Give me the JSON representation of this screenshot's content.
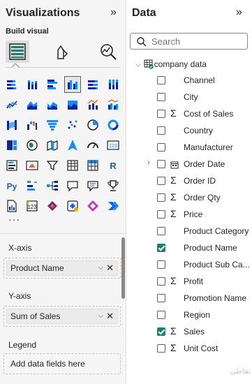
{
  "viz_pane": {
    "title": "Visualizations",
    "collapse_glyph": "»",
    "build_label": "Build visual",
    "modes": [
      "build-visual-icon",
      "format-visual-icon",
      "analytics-icon"
    ],
    "more_glyph": "···",
    "wells": [
      {
        "label": "X-axis",
        "value": "Product Name"
      },
      {
        "label": "Y-axis",
        "value": "Sum of Sales"
      },
      {
        "label": "Legend",
        "placeholder": "Add data fields here"
      }
    ],
    "pill_chevron": "⌵",
    "pill_remove": "✕",
    "selected_visual": "clustered-column-chart-icon"
  },
  "data_pane": {
    "title": "Data",
    "collapse_glyph": "»",
    "search_placeholder": "Search",
    "table": {
      "name": "company data",
      "expanded": true
    },
    "fields": [
      {
        "name": "Channel",
        "checked": false,
        "sigma": false
      },
      {
        "name": "City",
        "checked": false,
        "sigma": false
      },
      {
        "name": "Cost of Sales",
        "checked": false,
        "sigma": true
      },
      {
        "name": "Country",
        "checked": false,
        "sigma": false
      },
      {
        "name": "Manufacturer",
        "checked": false,
        "sigma": false
      },
      {
        "name": "Order Date",
        "checked": false,
        "sigma": false,
        "date": true,
        "expandable": true
      },
      {
        "name": "Order ID",
        "checked": false,
        "sigma": true
      },
      {
        "name": "Order Qty",
        "checked": false,
        "sigma": true
      },
      {
        "name": "Price",
        "checked": false,
        "sigma": true
      },
      {
        "name": "Product Category",
        "checked": false,
        "sigma": false
      },
      {
        "name": "Product Name",
        "checked": true,
        "sigma": false
      },
      {
        "name": "Product Sub Ca...",
        "checked": false,
        "sigma": false
      },
      {
        "name": "Profit",
        "checked": false,
        "sigma": true
      },
      {
        "name": "Promotion Name",
        "checked": false,
        "sigma": false
      },
      {
        "name": "Region",
        "checked": false,
        "sigma": false
      },
      {
        "name": "Sales",
        "checked": true,
        "sigma": true
      },
      {
        "name": "Unit Cost",
        "checked": false,
        "sigma": true
      }
    ],
    "watermark": "نقاطي"
  },
  "colors": {
    "accent": "#1e7f6e",
    "viz_blue": "#118dff",
    "viz_dark": "#12239e"
  }
}
